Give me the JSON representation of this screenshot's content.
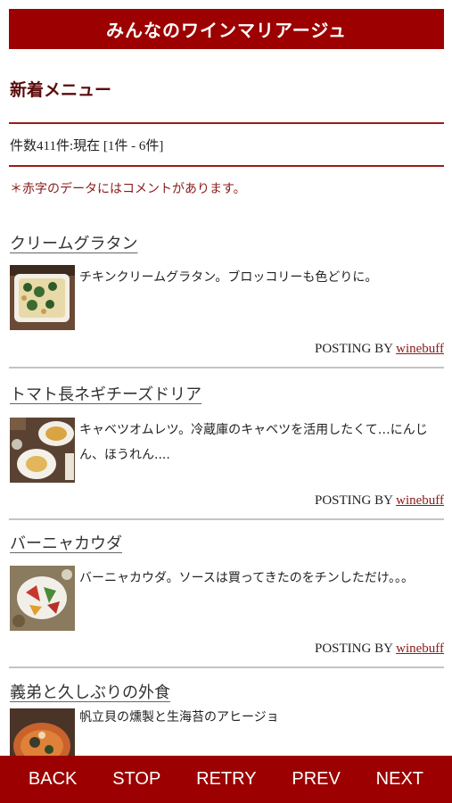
{
  "header": {
    "title": "みんなのワインマリアージュ"
  },
  "section": {
    "title": "新着メニュー",
    "count": "件数411件:現在  [1件 - 6件]",
    "note": "＊赤字のデータにはコメントがあります。"
  },
  "entries": [
    {
      "title": "クリームグラタン",
      "desc": "チキンクリームグラタン。ブロッコリーも色どりに。",
      "posting_prefix": "POSTING BY",
      "author": "winebuff"
    },
    {
      "title": "トマト長ネギチーズドリア",
      "desc": "キャベツオムレツ。冷蔵庫のキャベツを活用したくて…にんじん、ほうれん....",
      "posting_prefix": "POSTING BY",
      "author": "winebuff"
    },
    {
      "title": "バーニャカウダ",
      "desc": "バーニャカウダ。ソースは買ってきたのをチンしただけ。。。",
      "posting_prefix": "POSTING BY",
      "author": "winebuff"
    },
    {
      "title": "義弟と久しぶりの外食",
      "desc": "帆立貝の燻製と生海苔のアヒージョ"
    }
  ],
  "toolbar": {
    "back": "BACK",
    "stop": "STOP",
    "retry": "RETRY",
    "prev": "PREV",
    "next": "NEXT"
  },
  "colors": {
    "brand": "#9c0000",
    "accent_text": "#8a1a1a"
  }
}
